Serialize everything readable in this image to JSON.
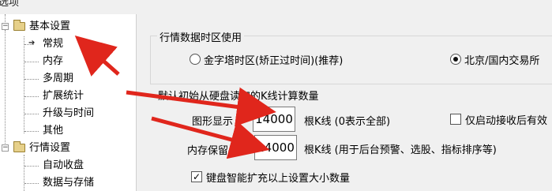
{
  "window": {
    "title_fragment": "选项"
  },
  "tree": {
    "groups": [
      {
        "label": "基本设置",
        "expander": "−",
        "items": [
          "常规",
          "内存",
          "多周期",
          "扩展统计",
          "升级与时间",
          "其他"
        ],
        "selected_marker": "➔"
      },
      {
        "label": "行情设置",
        "expander": "−",
        "items": [
          "自动收盘",
          "数据与存储"
        ]
      }
    ]
  },
  "timezone_group": {
    "title": "行情数据时区使用",
    "options": [
      {
        "label": "金字塔时区(矫正过时间)(推荐)",
        "checked": false
      },
      {
        "label": "北京/国内交易所",
        "checked": true
      }
    ]
  },
  "kline_section": {
    "title": "默认初始从硬盘读取的K线计算数量",
    "rows": [
      {
        "label": "图形显示",
        "value": "14000",
        "suffix": "根K线 (0表示全部)"
      },
      {
        "label": "内存保留",
        "value": "14000",
        "suffix": "根K线 (用于后台预警、选股、指标排序等)"
      }
    ],
    "only_on_receive": {
      "label": "仅启动接收后有效",
      "checked": false
    },
    "smart_expand": {
      "label": "键盘智能扩充以上设置大小数量",
      "checked": true,
      "mark": "✓"
    }
  },
  "colors": {
    "annotation_red": "#e0261c"
  }
}
